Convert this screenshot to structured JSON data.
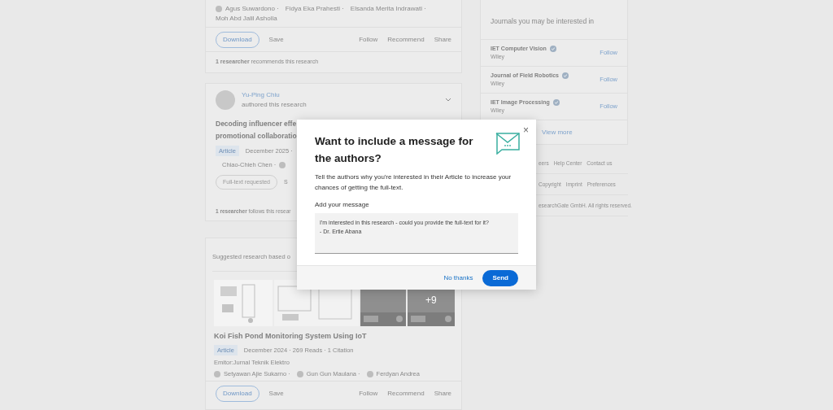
{
  "feed": {
    "card_1": {
      "authors": [
        "Agus Suwardono ·",
        "Fidya Eka Prahesti ·",
        "Elsanda Merita Indrawati ·",
        "Moh Abd Jalil Asholla"
      ],
      "actions": {
        "primary": "Download",
        "save": "Save",
        "follow": "Follow",
        "recommend": "Recommend",
        "share": "Share"
      },
      "footer": "**1 researcher** recommends this research"
    },
    "card_2": {
      "author": "Yu-Ping Chiu",
      "activity": "authored this research",
      "title_lines": [
        "Decoding influencer effe",
        "promotional collaboratio"
      ],
      "badge": "Article",
      "meta": "December 2025 ·",
      "authors": [
        "Chiao-Chieh Chen ·"
      ],
      "button": "Full-text requested",
      "button_2": "S",
      "footer": "**1 researcher** follows this resear"
    },
    "suggested_heading": "Suggested research based o",
    "card_3": {
      "more_images": "+9",
      "title": "Koi Fish Pond Monitoring System Using IoT",
      "badge": "Article",
      "meta": "December 2024 · 269 Reads · 1 Citation",
      "journal": "Emitor:Jurnal Teknik Elektro",
      "authors": [
        "Setyawan Ajie Sukarno ·",
        "Gun Gun Maulana ·",
        "Ferdyan Andrea"
      ],
      "actions": {
        "primary": "Download",
        "save": "Save",
        "follow": "Follow",
        "recommend": "Recommend",
        "share": "Share"
      }
    }
  },
  "sidebar": {
    "heading": "Journals you may be interested in",
    "journals": [
      {
        "name": "IET Computer Vision",
        "publisher": "Wiley",
        "action": "Follow"
      },
      {
        "name": "Journal of Field Robotics",
        "publisher": "Wiley",
        "action": "Follow"
      },
      {
        "name": "IET Image Processing",
        "publisher": "Wiley",
        "action": "Follow"
      }
    ],
    "view_more": "View more",
    "footer_rows": [
      [
        "eers",
        "Help Center",
        "Contact us"
      ],
      [
        "Copyright",
        "Imprint",
        "Preferences"
      ],
      [
        "esearchGate GmbH. All rights reserved."
      ]
    ]
  },
  "dialog": {
    "title": "Want to include a message for the authors?",
    "text": "Tell the authors why you're interested in their Article to increase your chances of getting the full-text.",
    "field_label": "Add your message",
    "message_lines": [
      "I'm interested in this research - could you provide the full-text for it?",
      "- Dr. Ertie Abana"
    ],
    "cancel": "No thanks",
    "submit": "Send",
    "close": "×"
  }
}
